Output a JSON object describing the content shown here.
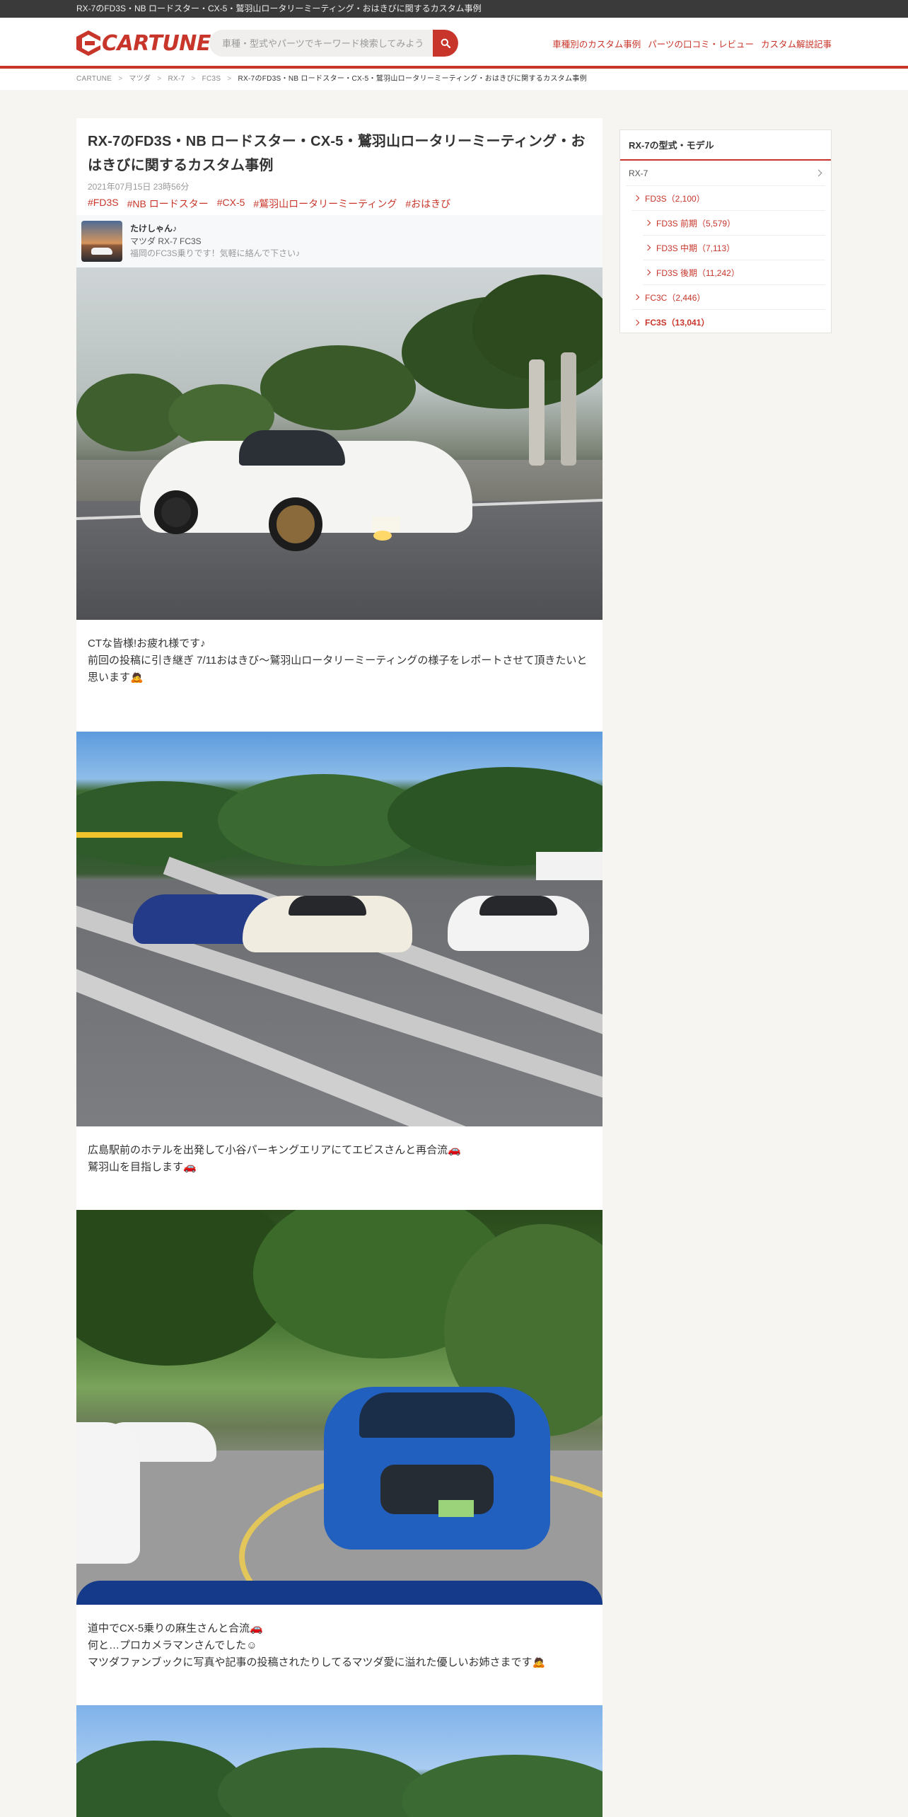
{
  "topbar": {
    "page_title": "RX-7のFD3S・NB ロードスター・CX-5・鷲羽山ロータリーミーティング・おはきびに関するカスタム事例"
  },
  "header": {
    "logo_text": "CARTUNE",
    "search_placeholder": "車種・型式やパーツでキーワード検索してみよう",
    "nav": [
      "車種別のカスタム事例",
      "パーツの口コミ・レビュー",
      "カスタム解説記事"
    ],
    "accent_color": "#c8362b"
  },
  "breadcrumb": [
    "CARTUNE",
    "マツダ",
    "RX-7",
    "FC3S",
    "RX-7のFD3S・NB ロードスター・CX-5・鷲羽山ロータリーミーティング・おはきびに関するカスタム事例"
  ],
  "article": {
    "title": "RX-7のFD3S・NB ロードスター・CX-5・鷲羽山ロータリーミーティング・おはきびに関するカスタム事例",
    "date": "2021年07月15日 23時56分",
    "tags": [
      "#FD3S",
      "#NB ロードスター",
      "#CX-5",
      "#鷲羽山ロータリーミーティング",
      "#おはきび"
    ],
    "author": {
      "name": "たけしゃん♪",
      "car": "マツダ RX-7 FC3S",
      "bio": "福岡のFC3S乗りです！気軽に絡んで下さい♪"
    },
    "captions": [
      "CTな皆様!お疲れ様です♪\n前回の投稿に引き継ぎ 7/11おはきび〜鷲羽山ロータリーミーティングの様子をレポートさせて頂きたいと思います🙇",
      "広島駅前のホテルを出発して小谷パーキングエリアにてエビスさんと再合流🚗\n鷲羽山を目指します🚗",
      "道中でCX-5乗りの麻生さんと合流🚗\n何と…プロカメラマンさんでした☺\nマツダファンブックに写真や記事の投稿されたりしてるマツダ愛に溢れた優しいお姉さまです🙇"
    ]
  },
  "sidebar": {
    "heading": "RX-7の型式・モデル",
    "root": "RX-7",
    "items": [
      {
        "label": "FD3S（2,100）",
        "level": 1
      },
      {
        "label": "FD3S 前期（5,579）",
        "level": 2
      },
      {
        "label": "FD3S 中期（7,113）",
        "level": 2
      },
      {
        "label": "FD3S 後期（11,242）",
        "level": 2
      },
      {
        "label": "FC3C（2,446）",
        "level": 1
      },
      {
        "label": "FC3S（13,041）",
        "level": 1
      }
    ]
  }
}
